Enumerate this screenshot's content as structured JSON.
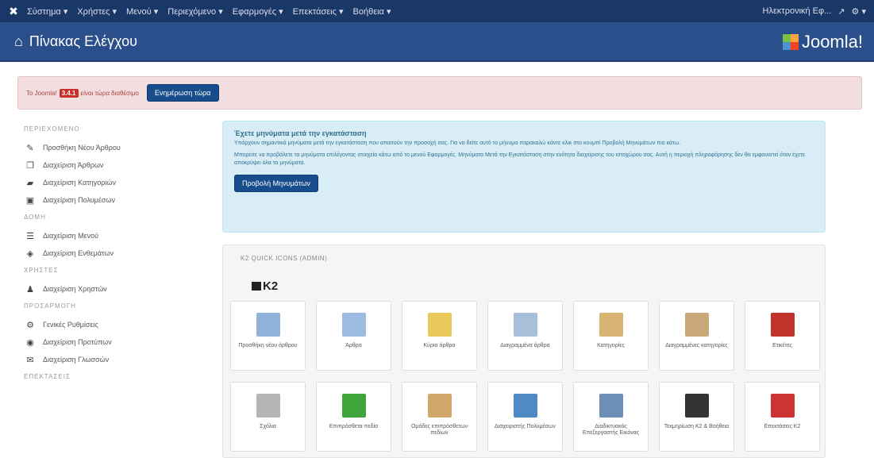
{
  "topbar": {
    "menu": [
      "Σύστημα ▾",
      "Χρήστες ▾",
      "Μενού ▾",
      "Περιεχόμενο ▾",
      "Εφαρμογές ▾",
      "Επεκτάσεις ▾",
      "Βοήθεια ▾"
    ],
    "site_link": "Ηλεκτρονική Εφ...",
    "settings": "⚙ ▾"
  },
  "header": {
    "title": "Πίνακας Ελέγχου",
    "brand": "Joomla!"
  },
  "alert": {
    "text1": "Το Joomla!",
    "version": "3.4.1",
    "text2": "είναι τώρα διαθέσιμο",
    "button": "Ενημέρωση τώρα"
  },
  "sidebar": {
    "sections": [
      {
        "title": "ΠΕΡΙΕΧΟΜΕΝΟ",
        "items": [
          "Προσθήκη Νέου Άρθρου",
          "Διαχείριση Άρθρων",
          "Διαχείριση Κατηγοριών",
          "Διαχείριση Πολυμέσων"
        ]
      },
      {
        "title": "ΔΟΜΗ",
        "items": [
          "Διαχείριση Μενού",
          "Διαχείριση Ενθεμάτων"
        ]
      },
      {
        "title": "ΧΡΗΣΤΕΣ",
        "items": [
          "Διαχείριση Χρηστών"
        ]
      },
      {
        "title": "ΠΡΟΣΑΡΜΟΓΗ",
        "items": [
          "Γενικές Ρυθμίσεις",
          "Διαχείριση Προτύπων",
          "Διαχείριση Γλωσσών"
        ]
      },
      {
        "title": "ΕΠΕΚΤΑΣΕΙΣ",
        "items": []
      }
    ]
  },
  "info": {
    "heading": "Έχετε μηνύματα μετά την εγκατάσταση",
    "p1": "Υπάρχουν σημαντικά μηνύματα μετά την εγκατάσταση που απαιτούν την προσοχή σας. Για να δείτε αυτό το μήνυμα παρακαλώ κάντε κλικ στο κουμπί Προβολή Μηνυμάτων πιο κάτω.",
    "p2": "Μπορείτε να προβάλετε τα μηνύματα επιλέγοντας στοιχεία κάτω από το μενού Εφαρμογές. Μηνύματα Μετά την Εγκατάσταση στην ενότητα διαχείρισης του ιστοχώρου σας. Αυτή η περιοχή πληροφόρησης δεν θα εμφανιστεί όταν έχετε αποκρύψει όλα τα μηνύματα.",
    "button": "Προβολή Μηνυμάτων"
  },
  "k2panel": {
    "title": "K2 QUICK ICONS (ADMIN)",
    "logo": "K2",
    "tiles": [
      {
        "label": "Προσθήκη νέου άρθρου",
        "color": "#8fb3d9"
      },
      {
        "label": "Άρθρα",
        "color": "#9bbbe0"
      },
      {
        "label": "Κύρια άρθρα",
        "color": "#e8c95a"
      },
      {
        "label": "Διαγραμμένα άρθρα",
        "color": "#a7bfd8"
      },
      {
        "label": "Κατηγορίες",
        "color": "#d8b474"
      },
      {
        "label": "Διαγραμμένες κατηγορίες",
        "color": "#c9a87a"
      },
      {
        "label": "Ετικέτες",
        "color": "#c2332b"
      },
      {
        "label": "Σχόλια",
        "color": "#b5b5b5"
      },
      {
        "label": "Επιπρόσθετα πεδία",
        "color": "#41a53c"
      },
      {
        "label": "Ομάδες επιπρόσθετων πεδίων",
        "color": "#d1a869"
      },
      {
        "label": "Διαχειριστής Πολυμέσων",
        "color": "#4d8ac6"
      },
      {
        "label": "Διαδικτυακός Επεξεργαστής Εικόνας",
        "color": "#6c8fb8"
      },
      {
        "label": "Τεκμηρίωση K2 & Βοήθεια",
        "color": "#333333"
      },
      {
        "label": "Επεκτάσεις K2",
        "color": "#cc3333"
      }
    ]
  }
}
